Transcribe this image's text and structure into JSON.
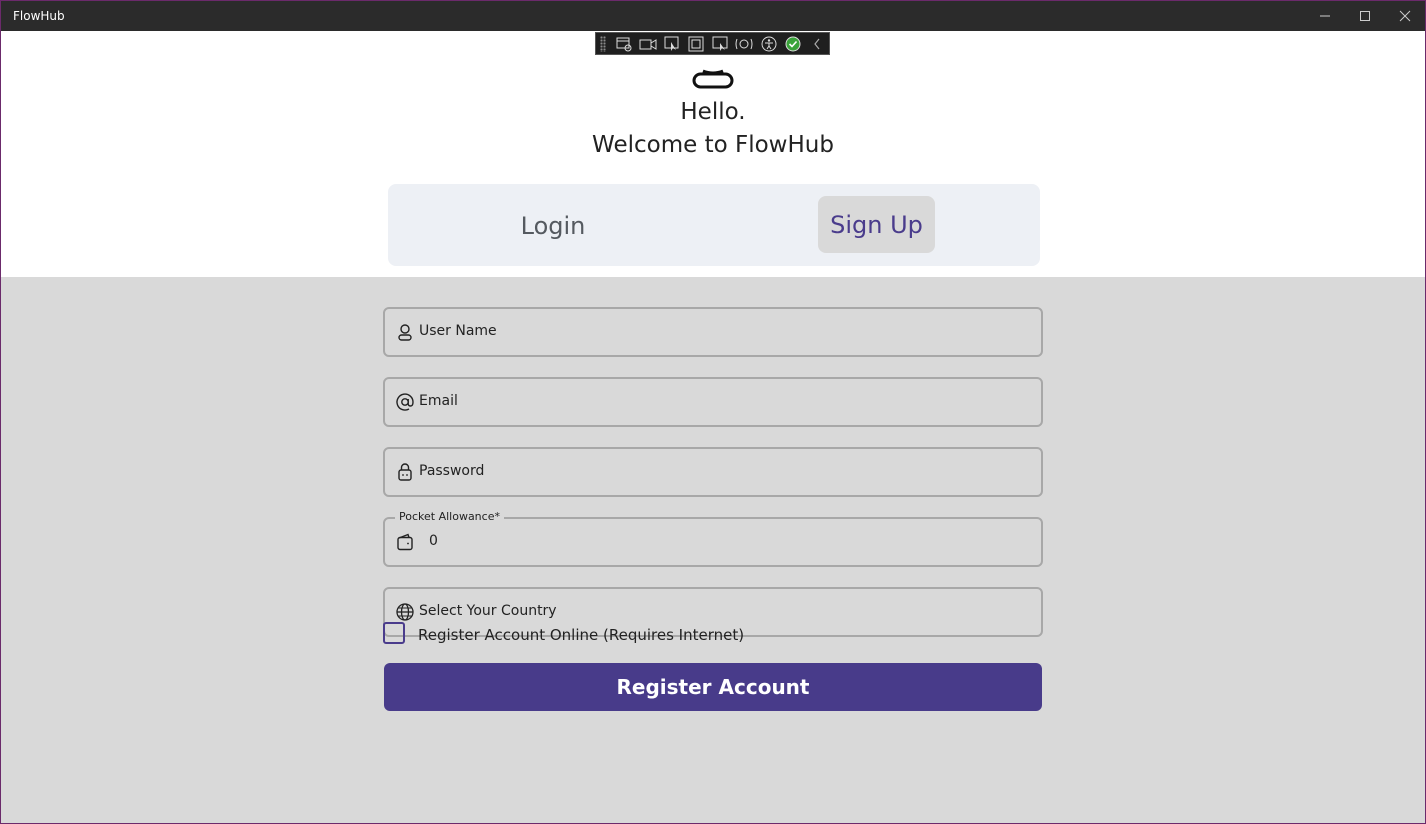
{
  "window": {
    "title": "FlowHub"
  },
  "header": {
    "greeting": "Hello.",
    "welcome": "Welcome to FlowHub"
  },
  "tabs": {
    "login": "Login",
    "signup": "Sign Up",
    "active": "signup",
    "active_color": "#4a3c8c"
  },
  "form": {
    "username_placeholder": "User Name",
    "email_placeholder": "Email",
    "password_placeholder": "Password",
    "allowance_label": "Pocket Allowance*",
    "allowance_value": "0",
    "country_placeholder": "Select Your Country",
    "online_checkbox_label": "Register Account Online (Requires Internet)",
    "online_checked": false,
    "submit_label": "Register Account"
  },
  "icons": {
    "username": "user-icon",
    "email": "at-icon",
    "password": "lock-icon",
    "allowance": "wallet-icon",
    "country": "globe-icon"
  },
  "colors": {
    "accent": "#483b8a",
    "form_background": "#d9d9d9",
    "tab_background": "#edf0f5"
  }
}
